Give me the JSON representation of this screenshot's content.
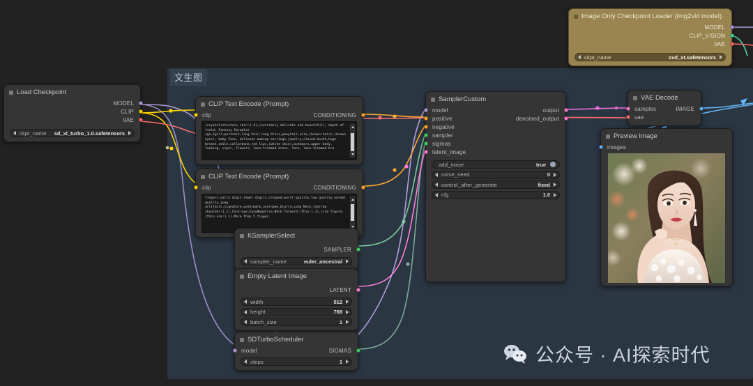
{
  "app": {
    "canvas_background": "#222222",
    "group_background": "#2b3643"
  },
  "group": {
    "title": "文生图"
  },
  "nodes": {
    "load_checkpoint": {
      "title": "Load Checkpoint",
      "outputs": [
        "MODEL",
        "CLIP",
        "VAE"
      ],
      "widgets": [
        {
          "name": "ckpt_name",
          "value": "sd_xl_turbo_1.0.safetensors"
        }
      ]
    },
    "img_loader": {
      "title": "Image Only Checkpoint Loader (img2vid model)",
      "outputs": [
        "MODEL",
        "CLIP_VISION",
        "VAE"
      ],
      "widgets": [
        {
          "name": "ckpt_name",
          "value": "svd_xt.safetensors"
        }
      ]
    },
    "clip_positive": {
      "title": "CLIP Text Encode (Prompt)",
      "input": "clip",
      "output": "CONDITIONING",
      "text": "(crystalsstexture skin:1.4),(extremely delicate and beautiful), depth of field, Fantasy Paradise\nvgn,1girl,portrait,long hair,long dress,ponytail,solo,(brown hair),(brown eyes), baby face, delicate makeup earrings,jewelry,closed mouth,huge breast,smile,collarbone,red lips,(white skin),outdoors,upper body, looking, viper, flowers, lace-trimmed dress, lace, lace-trimmed bra"
    },
    "clip_negative": {
      "title": "CLIP Text Encode (Prompt)",
      "input": "clip",
      "output": "CONDITIONING",
      "text": "fingers,extra digit,fewer digits,cropped,worst quality,low quality,normal quality,jpeg\nartifacts,signature,watermark,username,blurry,Long Neck,(narrow shoulder:1.1),Cock-eye,EasyNegative,Neck forward,(Thin:1.1),slim figure,(thin arm:1.1),More than 5 finger."
    },
    "ksampler_select": {
      "title": "KSamplerSelect",
      "output": "SAMPLER",
      "widgets": [
        {
          "name": "sampler_name",
          "value": "euler_ancestral"
        }
      ]
    },
    "empty_latent": {
      "title": "Empty Latent Image",
      "output": "LATENT",
      "widgets": [
        {
          "name": "width",
          "value": "512"
        },
        {
          "name": "height",
          "value": "768"
        },
        {
          "name": "batch_size",
          "value": "1"
        }
      ]
    },
    "sd_turbo_scheduler": {
      "title": "SDTurboScheduler",
      "input": "model",
      "output": "SIGMAS",
      "widgets": [
        {
          "name": "steps",
          "value": "1"
        }
      ]
    },
    "sampler_custom": {
      "title": "SamplerCustom",
      "inputs": [
        "model",
        "positive",
        "negative",
        "sampler",
        "sigmas",
        "latent_image"
      ],
      "outputs": [
        "output",
        "denoised_output"
      ],
      "widgets": [
        {
          "name": "add_noise",
          "value": "true",
          "type": "toggle"
        },
        {
          "name": "noise_seed",
          "value": "0"
        },
        {
          "name": "control_after_generate",
          "value": "fixed"
        },
        {
          "name": "cfg",
          "value": "1.0"
        }
      ]
    },
    "vae_decode": {
      "title": "VAE Decode",
      "inputs": [
        "samples",
        "vae"
      ],
      "outputs": [
        "IMAGE"
      ]
    },
    "preview_image": {
      "title": "Preview Image",
      "inputs": [
        "images"
      ]
    }
  },
  "watermark": {
    "text": "公众号 · AI探索时代"
  }
}
